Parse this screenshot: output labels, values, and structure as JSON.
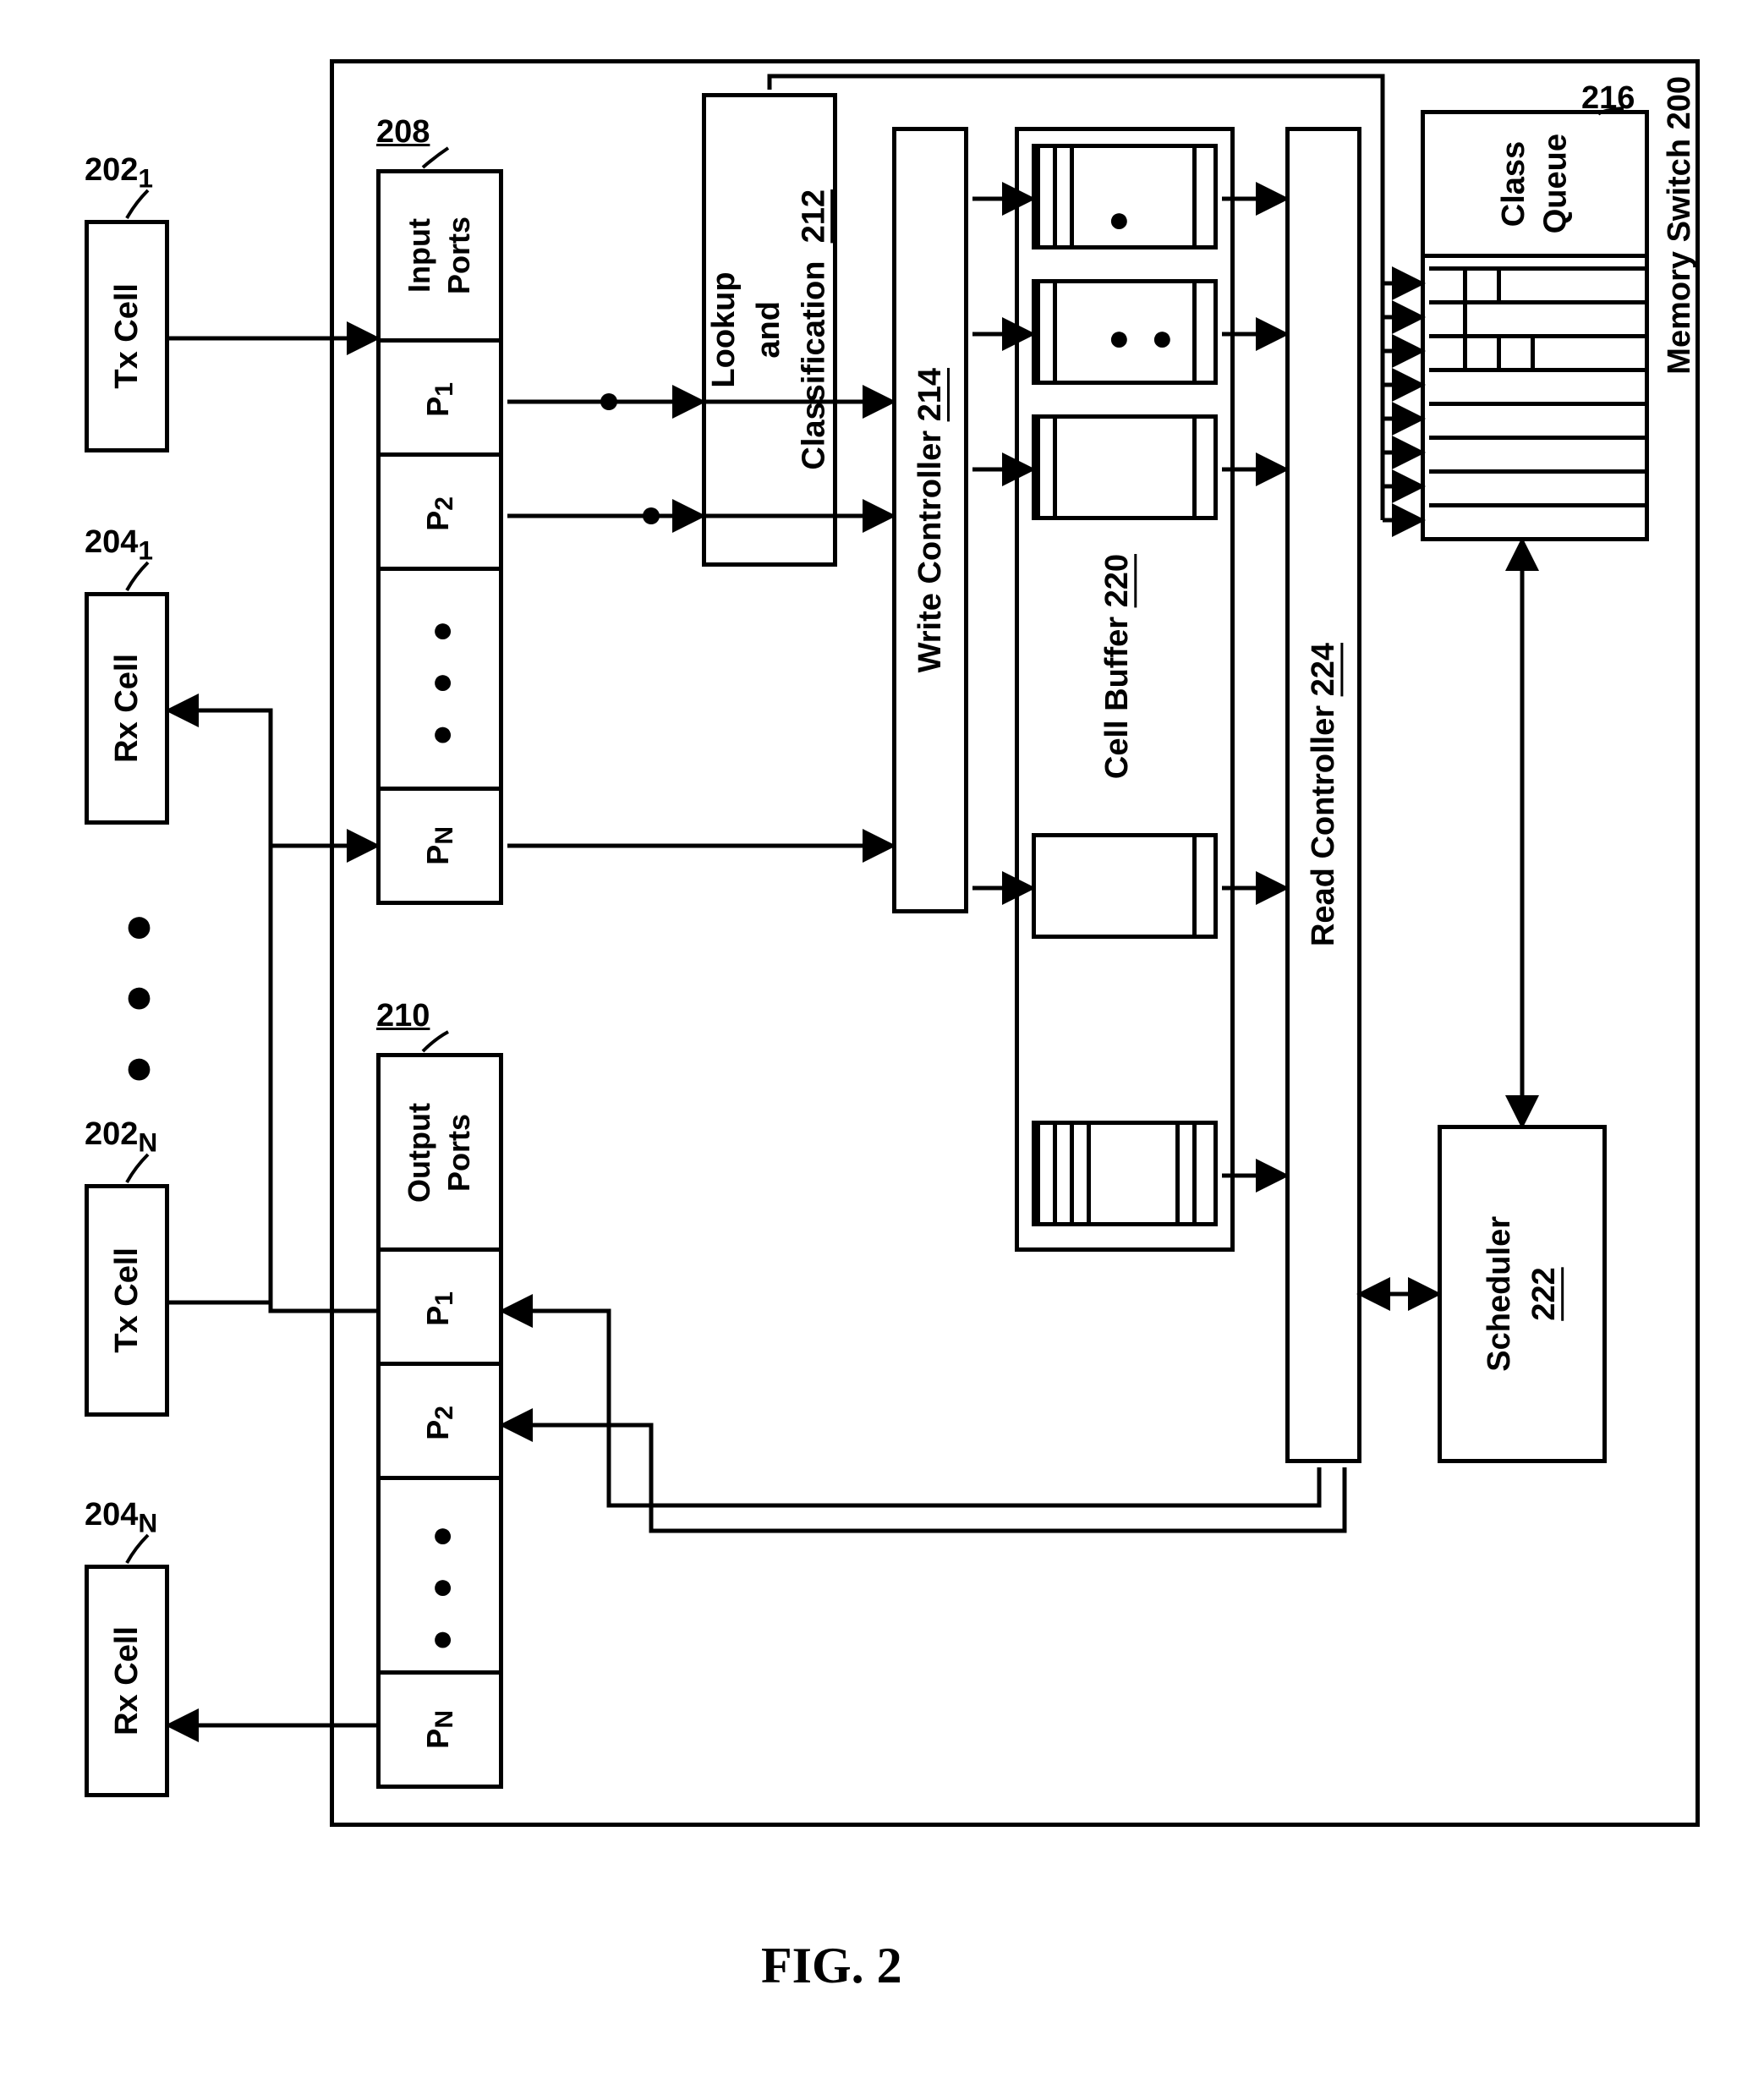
{
  "title": "Memory Switch",
  "fig_label": "FIG. 2",
  "refs": {
    "memory_switch": "200",
    "tx1": "202",
    "txN": "202",
    "rx1": "204",
    "rxN": "204",
    "input_ports": "208",
    "output_ports": "210",
    "lookup": "212",
    "write_controller": "214",
    "class_queue": "216",
    "cell_buffer": "220",
    "scheduler": "222",
    "read_controller": "224"
  },
  "sub": {
    "one": "1",
    "n": "N"
  },
  "blocks": {
    "tx_cell": "Tx Cell",
    "rx_cell": "Rx Cell",
    "input_ports": "Input\nPorts",
    "output_ports": "Output\nPorts",
    "p1": "P",
    "p2": "P",
    "pn": "P",
    "lookup": "Lookup\nand\nClassification",
    "write_controller": "Write Controller",
    "class_queue": "Class\nQueue",
    "cell_buffer": "Cell Buffer",
    "scheduler": "Scheduler",
    "read_controller": "Read Controller"
  },
  "port_sub": {
    "one": "1",
    "two": "2",
    "n": "N"
  }
}
